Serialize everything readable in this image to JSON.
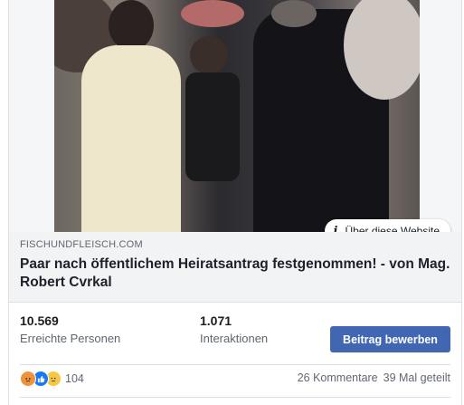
{
  "post": {
    "about_button_label": "Über diese Website",
    "link": {
      "domain": "FISCHUNDFLEISCH.COM",
      "title": "Paar nach öffentlichem Heiratsantrag festgenommen! - von Mag. Robert Cvrkal"
    },
    "stats": {
      "reach_value": "10.569",
      "reach_label": "Erreichte Personen",
      "interactions_value": "1.071",
      "interactions_label": "Interaktionen"
    },
    "boost_button_label": "Beitrag bewerben",
    "reactions": {
      "icons": [
        "angry-icon",
        "like-icon",
        "sad-icon"
      ],
      "count": "104"
    },
    "comments_label": "26 Kommentare",
    "shares_label": "39 Mal geteilt"
  },
  "colors": {
    "accent": "#4267b2",
    "angry": "#f0923b",
    "like": "#1877f2",
    "sad": "#f7c844"
  }
}
